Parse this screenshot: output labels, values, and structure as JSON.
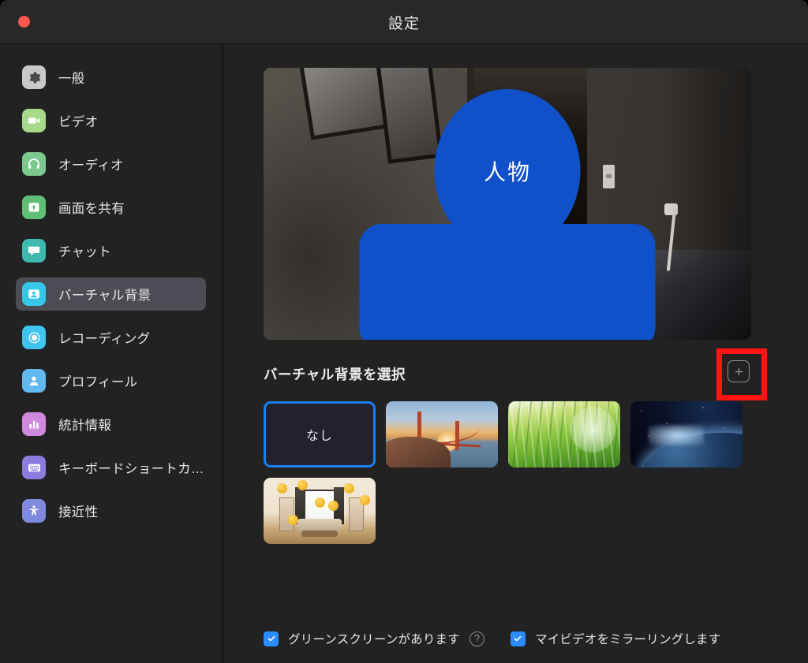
{
  "window": {
    "title": "設定",
    "close_button": "close-button"
  },
  "sidebar": {
    "items": [
      {
        "label": "一般",
        "icon": "gear-icon",
        "color": "#c9c9c9",
        "selected": false
      },
      {
        "label": "ビデオ",
        "icon": "video-camera-icon",
        "color": "#a6d98a",
        "selected": false
      },
      {
        "label": "オーディオ",
        "icon": "headphones-icon",
        "color": "#7cc98f",
        "selected": false
      },
      {
        "label": "画面を共有",
        "icon": "screen-share-icon",
        "color": "#5fbf74",
        "selected": false
      },
      {
        "label": "チャット",
        "icon": "chat-bubble-icon",
        "color": "#3fb8ae",
        "selected": false
      },
      {
        "label": "バーチャル背景",
        "icon": "person-card-icon",
        "color": "#35c6e8",
        "selected": true
      },
      {
        "label": "レコーディング",
        "icon": "record-icon",
        "color": "#3fc3ef",
        "selected": false
      },
      {
        "label": "プロフィール",
        "icon": "person-icon",
        "color": "#63b8f0",
        "selected": false
      },
      {
        "label": "統計情報",
        "icon": "bar-chart-icon",
        "color": "#cf8ade",
        "selected": false
      },
      {
        "label": "キーボードショートカ…",
        "icon": "keyboard-icon",
        "color": "#8d7ce0",
        "selected": false
      },
      {
        "label": "接近性",
        "icon": "accessibility-icon",
        "color": "#7f8ade",
        "selected": false
      }
    ]
  },
  "main": {
    "preview": {
      "person_label": "人物"
    },
    "section": {
      "title": "バーチャル背景を選択",
      "add_button_label": "+"
    },
    "thumbnails": [
      {
        "name": "なし",
        "kind": "none",
        "selected": true
      },
      {
        "name": "golden-gate-bridge",
        "kind": "bridge",
        "selected": false
      },
      {
        "name": "grass",
        "kind": "grass",
        "selected": false
      },
      {
        "name": "earth-space",
        "kind": "earth",
        "selected": false
      },
      {
        "name": "decorated-room",
        "kind": "room",
        "selected": false
      }
    ],
    "footer": {
      "green_screen": {
        "label": "グリーンスクリーンがあります",
        "checked": true,
        "help": "?"
      },
      "mirror_video": {
        "label": "マイビデオをミラーリングします",
        "checked": true
      }
    }
  },
  "colors": {
    "window_bg": "#222222",
    "titlebar_bg": "#282828",
    "selected_item_bg": "#4c4c55",
    "accent_blue": "#2d8cff",
    "selection_border": "#1a7ff0",
    "annotation_red": "#ff1414",
    "person_overlay": "#1050c8"
  }
}
